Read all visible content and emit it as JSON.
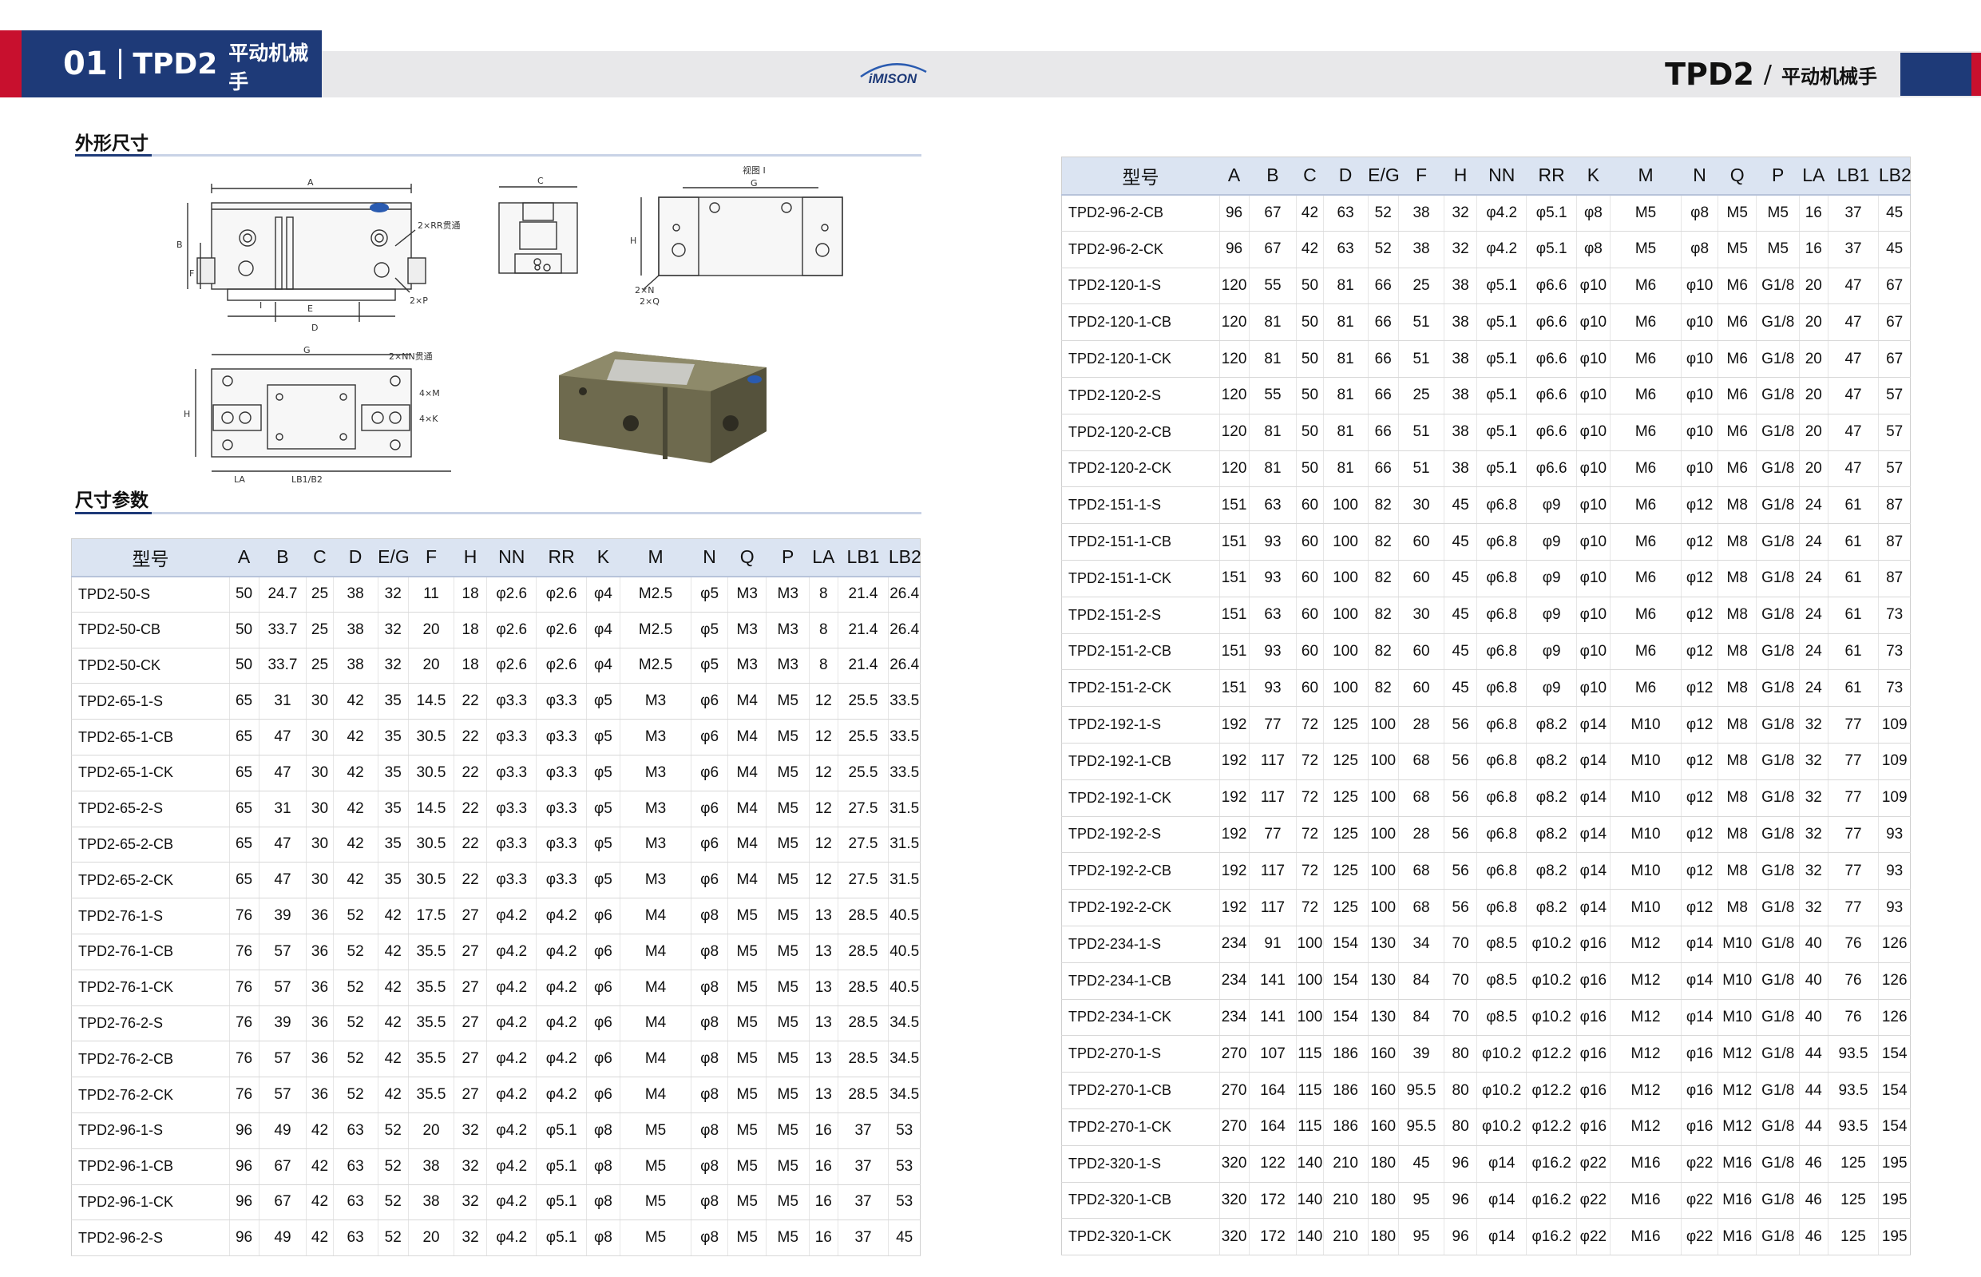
{
  "header": {
    "left_number": "01",
    "model": "TPD2",
    "model_cn": "平动机械手",
    "logo_text": "iMISON",
    "right_model": "TPD2",
    "right_slash": "/",
    "right_cn": "平动机械手"
  },
  "sections": {
    "outline": "外形尺寸",
    "params": "尺寸参数"
  },
  "drawing_labels": {
    "a": "A",
    "b": "B",
    "c": "C",
    "d": "D",
    "e": "E",
    "f": "F",
    "g": "G",
    "h": "H",
    "i": "I",
    "la": "LA",
    "lb": "LB1/B2",
    "rr": "2×RR贯通",
    "p": "2×P",
    "n": "2×N",
    "q": "2×Q",
    "nn": "2×NN贯通",
    "m4": "4×M",
    "k4": "4×K",
    "view": "视图 I"
  },
  "columns": [
    "型号",
    "A",
    "B",
    "C",
    "D",
    "E/G",
    "F",
    "H",
    "NN",
    "RR",
    "K",
    "M",
    "N",
    "Q",
    "P",
    "LA",
    "LB1",
    "LB2"
  ],
  "left_rows": [
    [
      "TPD2-50-S",
      "50",
      "24.7",
      "25",
      "38",
      "32",
      "11",
      "18",
      "φ2.6",
      "φ2.6",
      "φ4",
      "M2.5",
      "φ5",
      "M3",
      "M3",
      "8",
      "21.4",
      "26.4"
    ],
    [
      "TPD2-50-CB",
      "50",
      "33.7",
      "25",
      "38",
      "32",
      "20",
      "18",
      "φ2.6",
      "φ2.6",
      "φ4",
      "M2.5",
      "φ5",
      "M3",
      "M3",
      "8",
      "21.4",
      "26.4"
    ],
    [
      "TPD2-50-CK",
      "50",
      "33.7",
      "25",
      "38",
      "32",
      "20",
      "18",
      "φ2.6",
      "φ2.6",
      "φ4",
      "M2.5",
      "φ5",
      "M3",
      "M3",
      "8",
      "21.4",
      "26.4"
    ],
    [
      "TPD2-65-1-S",
      "65",
      "31",
      "30",
      "42",
      "35",
      "14.5",
      "22",
      "φ3.3",
      "φ3.3",
      "φ5",
      "M3",
      "φ6",
      "M4",
      "M5",
      "12",
      "25.5",
      "33.5"
    ],
    [
      "TPD2-65-1-CB",
      "65",
      "47",
      "30",
      "42",
      "35",
      "30.5",
      "22",
      "φ3.3",
      "φ3.3",
      "φ5",
      "M3",
      "φ6",
      "M4",
      "M5",
      "12",
      "25.5",
      "33.5"
    ],
    [
      "TPD2-65-1-CK",
      "65",
      "47",
      "30",
      "42",
      "35",
      "30.5",
      "22",
      "φ3.3",
      "φ3.3",
      "φ5",
      "M3",
      "φ6",
      "M4",
      "M5",
      "12",
      "25.5",
      "33.5"
    ],
    [
      "TPD2-65-2-S",
      "65",
      "31",
      "30",
      "42",
      "35",
      "14.5",
      "22",
      "φ3.3",
      "φ3.3",
      "φ5",
      "M3",
      "φ6",
      "M4",
      "M5",
      "12",
      "27.5",
      "31.5"
    ],
    [
      "TPD2-65-2-CB",
      "65",
      "47",
      "30",
      "42",
      "35",
      "30.5",
      "22",
      "φ3.3",
      "φ3.3",
      "φ5",
      "M3",
      "φ6",
      "M4",
      "M5",
      "12",
      "27.5",
      "31.5"
    ],
    [
      "TPD2-65-2-CK",
      "65",
      "47",
      "30",
      "42",
      "35",
      "30.5",
      "22",
      "φ3.3",
      "φ3.3",
      "φ5",
      "M3",
      "φ6",
      "M4",
      "M5",
      "12",
      "27.5",
      "31.5"
    ],
    [
      "TPD2-76-1-S",
      "76",
      "39",
      "36",
      "52",
      "42",
      "17.5",
      "27",
      "φ4.2",
      "φ4.2",
      "φ6",
      "M4",
      "φ8",
      "M5",
      "M5",
      "13",
      "28.5",
      "40.5"
    ],
    [
      "TPD2-76-1-CB",
      "76",
      "57",
      "36",
      "52",
      "42",
      "35.5",
      "27",
      "φ4.2",
      "φ4.2",
      "φ6",
      "M4",
      "φ8",
      "M5",
      "M5",
      "13",
      "28.5",
      "40.5"
    ],
    [
      "TPD2-76-1-CK",
      "76",
      "57",
      "36",
      "52",
      "42",
      "35.5",
      "27",
      "φ4.2",
      "φ4.2",
      "φ6",
      "M4",
      "φ8",
      "M5",
      "M5",
      "13",
      "28.5",
      "40.5"
    ],
    [
      "TPD2-76-2-S",
      "76",
      "39",
      "36",
      "52",
      "42",
      "35.5",
      "27",
      "φ4.2",
      "φ4.2",
      "φ6",
      "M4",
      "φ8",
      "M5",
      "M5",
      "13",
      "28.5",
      "34.5"
    ],
    [
      "TPD2-76-2-CB",
      "76",
      "57",
      "36",
      "52",
      "42",
      "35.5",
      "27",
      "φ4.2",
      "φ4.2",
      "φ6",
      "M4",
      "φ8",
      "M5",
      "M5",
      "13",
      "28.5",
      "34.5"
    ],
    [
      "TPD2-76-2-CK",
      "76",
      "57",
      "36",
      "52",
      "42",
      "35.5",
      "27",
      "φ4.2",
      "φ4.2",
      "φ6",
      "M4",
      "φ8",
      "M5",
      "M5",
      "13",
      "28.5",
      "34.5"
    ],
    [
      "TPD2-96-1-S",
      "96",
      "49",
      "42",
      "63",
      "52",
      "20",
      "32",
      "φ4.2",
      "φ5.1",
      "φ8",
      "M5",
      "φ8",
      "M5",
      "M5",
      "16",
      "37",
      "53"
    ],
    [
      "TPD2-96-1-CB",
      "96",
      "67",
      "42",
      "63",
      "52",
      "38",
      "32",
      "φ4.2",
      "φ5.1",
      "φ8",
      "M5",
      "φ8",
      "M5",
      "M5",
      "16",
      "37",
      "53"
    ],
    [
      "TPD2-96-1-CK",
      "96",
      "67",
      "42",
      "63",
      "52",
      "38",
      "32",
      "φ4.2",
      "φ5.1",
      "φ8",
      "M5",
      "φ8",
      "M5",
      "M5",
      "16",
      "37",
      "53"
    ],
    [
      "TPD2-96-2-S",
      "96",
      "49",
      "42",
      "63",
      "52",
      "20",
      "32",
      "φ4.2",
      "φ5.1",
      "φ8",
      "M5",
      "φ8",
      "M5",
      "M5",
      "16",
      "37",
      "45"
    ]
  ],
  "right_rows": [
    [
      "TPD2-96-2-CB",
      "96",
      "67",
      "42",
      "63",
      "52",
      "38",
      "32",
      "φ4.2",
      "φ5.1",
      "φ8",
      "M5",
      "φ8",
      "M5",
      "M5",
      "16",
      "37",
      "45"
    ],
    [
      "TPD2-96-2-CK",
      "96",
      "67",
      "42",
      "63",
      "52",
      "38",
      "32",
      "φ4.2",
      "φ5.1",
      "φ8",
      "M5",
      "φ8",
      "M5",
      "M5",
      "16",
      "37",
      "45"
    ],
    [
      "TPD2-120-1-S",
      "120",
      "55",
      "50",
      "81",
      "66",
      "25",
      "38",
      "φ5.1",
      "φ6.6",
      "φ10",
      "M6",
      "φ10",
      "M6",
      "G1/8",
      "20",
      "47",
      "67"
    ],
    [
      "TPD2-120-1-CB",
      "120",
      "81",
      "50",
      "81",
      "66",
      "51",
      "38",
      "φ5.1",
      "φ6.6",
      "φ10",
      "M6",
      "φ10",
      "M6",
      "G1/8",
      "20",
      "47",
      "67"
    ],
    [
      "TPD2-120-1-CK",
      "120",
      "81",
      "50",
      "81",
      "66",
      "51",
      "38",
      "φ5.1",
      "φ6.6",
      "φ10",
      "M6",
      "φ10",
      "M6",
      "G1/8",
      "20",
      "47",
      "67"
    ],
    [
      "TPD2-120-2-S",
      "120",
      "55",
      "50",
      "81",
      "66",
      "25",
      "38",
      "φ5.1",
      "φ6.6",
      "φ10",
      "M6",
      "φ10",
      "M6",
      "G1/8",
      "20",
      "47",
      "57"
    ],
    [
      "TPD2-120-2-CB",
      "120",
      "81",
      "50",
      "81",
      "66",
      "51",
      "38",
      "φ5.1",
      "φ6.6",
      "φ10",
      "M6",
      "φ10",
      "M6",
      "G1/8",
      "20",
      "47",
      "57"
    ],
    [
      "TPD2-120-2-CK",
      "120",
      "81",
      "50",
      "81",
      "66",
      "51",
      "38",
      "φ5.1",
      "φ6.6",
      "φ10",
      "M6",
      "φ10",
      "M6",
      "G1/8",
      "20",
      "47",
      "57"
    ],
    [
      "TPD2-151-1-S",
      "151",
      "63",
      "60",
      "100",
      "82",
      "30",
      "45",
      "φ6.8",
      "φ9",
      "φ10",
      "M6",
      "φ12",
      "M8",
      "G1/8",
      "24",
      "61",
      "87"
    ],
    [
      "TPD2-151-1-CB",
      "151",
      "93",
      "60",
      "100",
      "82",
      "60",
      "45",
      "φ6.8",
      "φ9",
      "φ10",
      "M6",
      "φ12",
      "M8",
      "G1/8",
      "24",
      "61",
      "87"
    ],
    [
      "TPD2-151-1-CK",
      "151",
      "93",
      "60",
      "100",
      "82",
      "60",
      "45",
      "φ6.8",
      "φ9",
      "φ10",
      "M6",
      "φ12",
      "M8",
      "G1/8",
      "24",
      "61",
      "87"
    ],
    [
      "TPD2-151-2-S",
      "151",
      "63",
      "60",
      "100",
      "82",
      "30",
      "45",
      "φ6.8",
      "φ9",
      "φ10",
      "M6",
      "φ12",
      "M8",
      "G1/8",
      "24",
      "61",
      "73"
    ],
    [
      "TPD2-151-2-CB",
      "151",
      "93",
      "60",
      "100",
      "82",
      "60",
      "45",
      "φ6.8",
      "φ9",
      "φ10",
      "M6",
      "φ12",
      "M8",
      "G1/8",
      "24",
      "61",
      "73"
    ],
    [
      "TPD2-151-2-CK",
      "151",
      "93",
      "60",
      "100",
      "82",
      "60",
      "45",
      "φ6.8",
      "φ9",
      "φ10",
      "M6",
      "φ12",
      "M8",
      "G1/8",
      "24",
      "61",
      "73"
    ],
    [
      "TPD2-192-1-S",
      "192",
      "77",
      "72",
      "125",
      "100",
      "28",
      "56",
      "φ6.8",
      "φ8.2",
      "φ14",
      "M10",
      "φ12",
      "M8",
      "G1/8",
      "32",
      "77",
      "109"
    ],
    [
      "TPD2-192-1-CB",
      "192",
      "117",
      "72",
      "125",
      "100",
      "68",
      "56",
      "φ6.8",
      "φ8.2",
      "φ14",
      "M10",
      "φ12",
      "M8",
      "G1/8",
      "32",
      "77",
      "109"
    ],
    [
      "TPD2-192-1-CK",
      "192",
      "117",
      "72",
      "125",
      "100",
      "68",
      "56",
      "φ6.8",
      "φ8.2",
      "φ14",
      "M10",
      "φ12",
      "M8",
      "G1/8",
      "32",
      "77",
      "109"
    ],
    [
      "TPD2-192-2-S",
      "192",
      "77",
      "72",
      "125",
      "100",
      "28",
      "56",
      "φ6.8",
      "φ8.2",
      "φ14",
      "M10",
      "φ12",
      "M8",
      "G1/8",
      "32",
      "77",
      "93"
    ],
    [
      "TPD2-192-2-CB",
      "192",
      "117",
      "72",
      "125",
      "100",
      "68",
      "56",
      "φ6.8",
      "φ8.2",
      "φ14",
      "M10",
      "φ12",
      "M8",
      "G1/8",
      "32",
      "77",
      "93"
    ],
    [
      "TPD2-192-2-CK",
      "192",
      "117",
      "72",
      "125",
      "100",
      "68",
      "56",
      "φ6.8",
      "φ8.2",
      "φ14",
      "M10",
      "φ12",
      "M8",
      "G1/8",
      "32",
      "77",
      "93"
    ],
    [
      "TPD2-234-1-S",
      "234",
      "91",
      "100",
      "154",
      "130",
      "34",
      "70",
      "φ8.5",
      "φ10.2",
      "φ16",
      "M12",
      "φ14",
      "M10",
      "G1/8",
      "40",
      "76",
      "126"
    ],
    [
      "TPD2-234-1-CB",
      "234",
      "141",
      "100",
      "154",
      "130",
      "84",
      "70",
      "φ8.5",
      "φ10.2",
      "φ16",
      "M12",
      "φ14",
      "M10",
      "G1/8",
      "40",
      "76",
      "126"
    ],
    [
      "TPD2-234-1-CK",
      "234",
      "141",
      "100",
      "154",
      "130",
      "84",
      "70",
      "φ8.5",
      "φ10.2",
      "φ16",
      "M12",
      "φ14",
      "M10",
      "G1/8",
      "40",
      "76",
      "126"
    ],
    [
      "TPD2-270-1-S",
      "270",
      "107",
      "115",
      "186",
      "160",
      "39",
      "80",
      "φ10.2",
      "φ12.2",
      "φ16",
      "M12",
      "φ16",
      "M12",
      "G1/8",
      "44",
      "93.5",
      "154"
    ],
    [
      "TPD2-270-1-CB",
      "270",
      "164",
      "115",
      "186",
      "160",
      "95.5",
      "80",
      "φ10.2",
      "φ12.2",
      "φ16",
      "M12",
      "φ16",
      "M12",
      "G1/8",
      "44",
      "93.5",
      "154"
    ],
    [
      "TPD2-270-1-CK",
      "270",
      "164",
      "115",
      "186",
      "160",
      "95.5",
      "80",
      "φ10.2",
      "φ12.2",
      "φ16",
      "M12",
      "φ16",
      "M12",
      "G1/8",
      "44",
      "93.5",
      "154"
    ],
    [
      "TPD2-320-1-S",
      "320",
      "122",
      "140",
      "210",
      "180",
      "45",
      "96",
      "φ14",
      "φ16.2",
      "φ22",
      "M16",
      "φ22",
      "M16",
      "G1/8",
      "46",
      "125",
      "195"
    ],
    [
      "TPD2-320-1-CB",
      "320",
      "172",
      "140",
      "210",
      "180",
      "95",
      "96",
      "φ14",
      "φ16.2",
      "φ22",
      "M16",
      "φ22",
      "M16",
      "G1/8",
      "46",
      "125",
      "195"
    ],
    [
      "TPD2-320-1-CK",
      "320",
      "172",
      "140",
      "210",
      "180",
      "95",
      "96",
      "φ14",
      "φ16.2",
      "φ22",
      "M16",
      "φ22",
      "M16",
      "G1/8",
      "46",
      "125",
      "195"
    ]
  ]
}
